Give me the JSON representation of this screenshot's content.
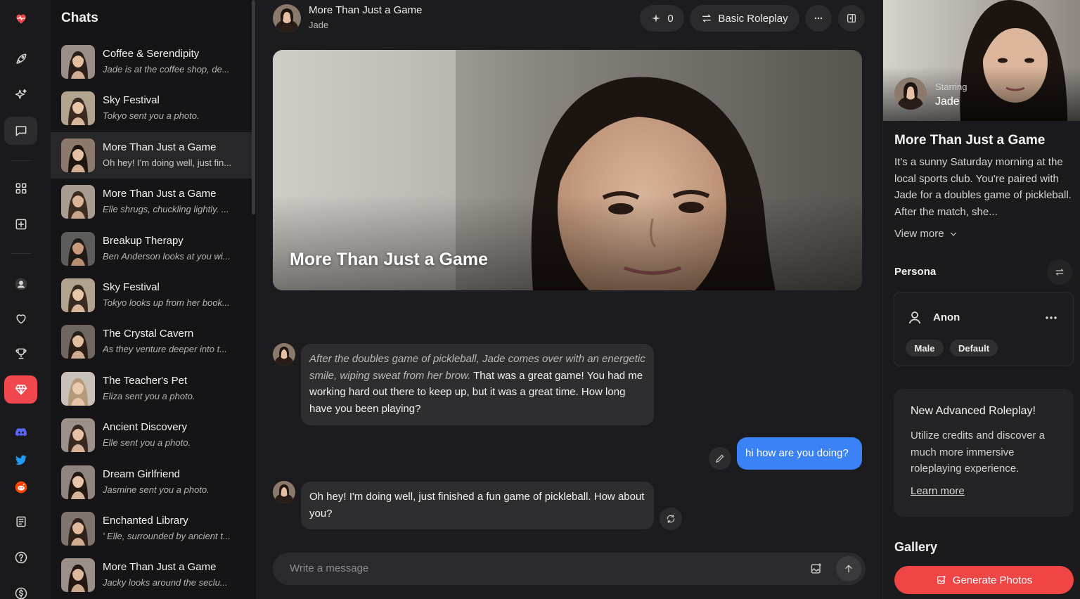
{
  "rail": {
    "items": [
      {
        "name": "logo-heart-icon"
      },
      {
        "name": "rocket-icon"
      },
      {
        "name": "sparkles-icon"
      },
      {
        "name": "chat-icon"
      },
      {
        "name": "grid-icon"
      },
      {
        "name": "add-square-icon"
      },
      {
        "name": "user-icon"
      },
      {
        "name": "heart-icon"
      },
      {
        "name": "trophy-icon"
      },
      {
        "name": "diamond-icon"
      },
      {
        "name": "discord-icon"
      },
      {
        "name": "twitter-icon"
      },
      {
        "name": "reddit-icon"
      },
      {
        "name": "news-icon"
      },
      {
        "name": "help-icon"
      },
      {
        "name": "dollar-icon"
      }
    ]
  },
  "chatlist": {
    "title": "Chats",
    "items": [
      {
        "title": "Coffee & Serendipity",
        "preview": "Jade is at the coffee shop, de..."
      },
      {
        "title": "Sky Festival",
        "preview": "Tokyo sent you a photo."
      },
      {
        "title": "More Than Just a Game",
        "preview": "Oh hey! I'm doing well, just fin..."
      },
      {
        "title": "More Than Just a Game",
        "preview": "Elle shrugs, chuckling lightly. ..."
      },
      {
        "title": "Breakup Therapy",
        "preview": "Ben Anderson looks at you wi..."
      },
      {
        "title": "Sky Festival",
        "preview": "Tokyo looks up from her book..."
      },
      {
        "title": "The Crystal Cavern",
        "preview": "As they venture deeper into t..."
      },
      {
        "title": "The Teacher's Pet",
        "preview": "Eliza sent you a photo."
      },
      {
        "title": "Ancient Discovery",
        "preview": "Elle sent you a photo."
      },
      {
        "title": "Dream Girlfriend",
        "preview": "Jasmine sent you a photo."
      },
      {
        "title": "Enchanted Library",
        "preview": "' Elle, surrounded by ancient t..."
      },
      {
        "title": "More Than Just a Game",
        "preview": "Jacky looks around the seclu..."
      }
    ]
  },
  "header": {
    "title": "More Than Just a Game",
    "subtitle": "Jade",
    "credits": "0",
    "mode": "Basic Roleplay"
  },
  "banner": {
    "title": "More Than Just a Game"
  },
  "messages": {
    "m1_action": "After the doubles game of pickleball, Jade comes over with an energetic smile, wiping sweat from her brow.",
    "m1_text": " That was a great game! You had me working hard out there to keep up, but it was a great time. How long have you been playing?",
    "user": "hi how are you doing?",
    "m2_text": "Oh hey! I'm doing well, just finished a fun game of pickleball. How about you?"
  },
  "composer": {
    "placeholder": "Write a message"
  },
  "right": {
    "starring_label": "Starring",
    "starring_name": "Jade",
    "title": "More Than Just a Game",
    "description": "It's a sunny Saturday morning at the local sports club. You're paired with Jade for a doubles game of pickleball. After the match, she...",
    "view_more": "View more",
    "persona_heading": "Persona",
    "persona_name": "Anon",
    "persona_tags": [
      "Male",
      "Default"
    ],
    "promo_title": "New Advanced Roleplay!",
    "promo_body": "Utilize credits and discover a much more immersive roleplaying experience.",
    "promo_link": "Learn more",
    "gallery_heading": "Gallery",
    "generate_label": "Generate Photos"
  },
  "colors": {
    "accent_red": "#ef4545",
    "user_bubble": "#3b82f6",
    "bg": "#1b1b1d"
  }
}
